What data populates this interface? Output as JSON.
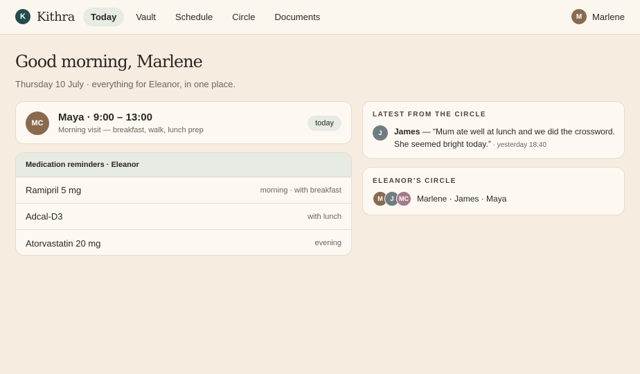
{
  "brand": {
    "logo_letter": "K",
    "name": "Kithra"
  },
  "nav": {
    "tabs": [
      {
        "label": "Today",
        "active": true
      },
      {
        "label": "Vault",
        "active": false
      },
      {
        "label": "Schedule",
        "active": false
      },
      {
        "label": "Circle",
        "active": false
      },
      {
        "label": "Documents",
        "active": false
      }
    ]
  },
  "user": {
    "initial": "M",
    "name": "Marlene"
  },
  "greeting": {
    "title": "Good morning, Marlene",
    "subtitle": "Thursday 10 July · everything for Eleanor, in one place."
  },
  "visit": {
    "avatar_initials": "MC",
    "title": "Maya · 9:00 – 13:00",
    "description": "Morning visit — breakfast, walk, lunch prep",
    "badge": "today"
  },
  "medications": {
    "header": "Medication reminders · Eleanor",
    "items": [
      {
        "name": "Ramipril 5 mg",
        "time": "morning · with breakfast"
      },
      {
        "name": "Adcal-D3",
        "time": "with lunch"
      },
      {
        "name": "Atorvastatin 20 mg",
        "time": "evening"
      }
    ]
  },
  "latest": {
    "heading": "LATEST FROM THE CIRCLE",
    "avatar_initial": "J",
    "author": "James",
    "message": " — “Mum ate well at lunch and we did the crossword. She seemed bright today.”",
    "time": " · yesterday 18:40"
  },
  "circle": {
    "heading": "ELEANOR’S CIRCLE",
    "avatars": [
      "M",
      "J",
      "MC"
    ],
    "members": "Marlene · James · Maya"
  },
  "colors": {
    "background": "#f6ede0",
    "brand": "#234c4f",
    "active_tab": "#e6ebe4",
    "card": "#fdf9f2"
  }
}
